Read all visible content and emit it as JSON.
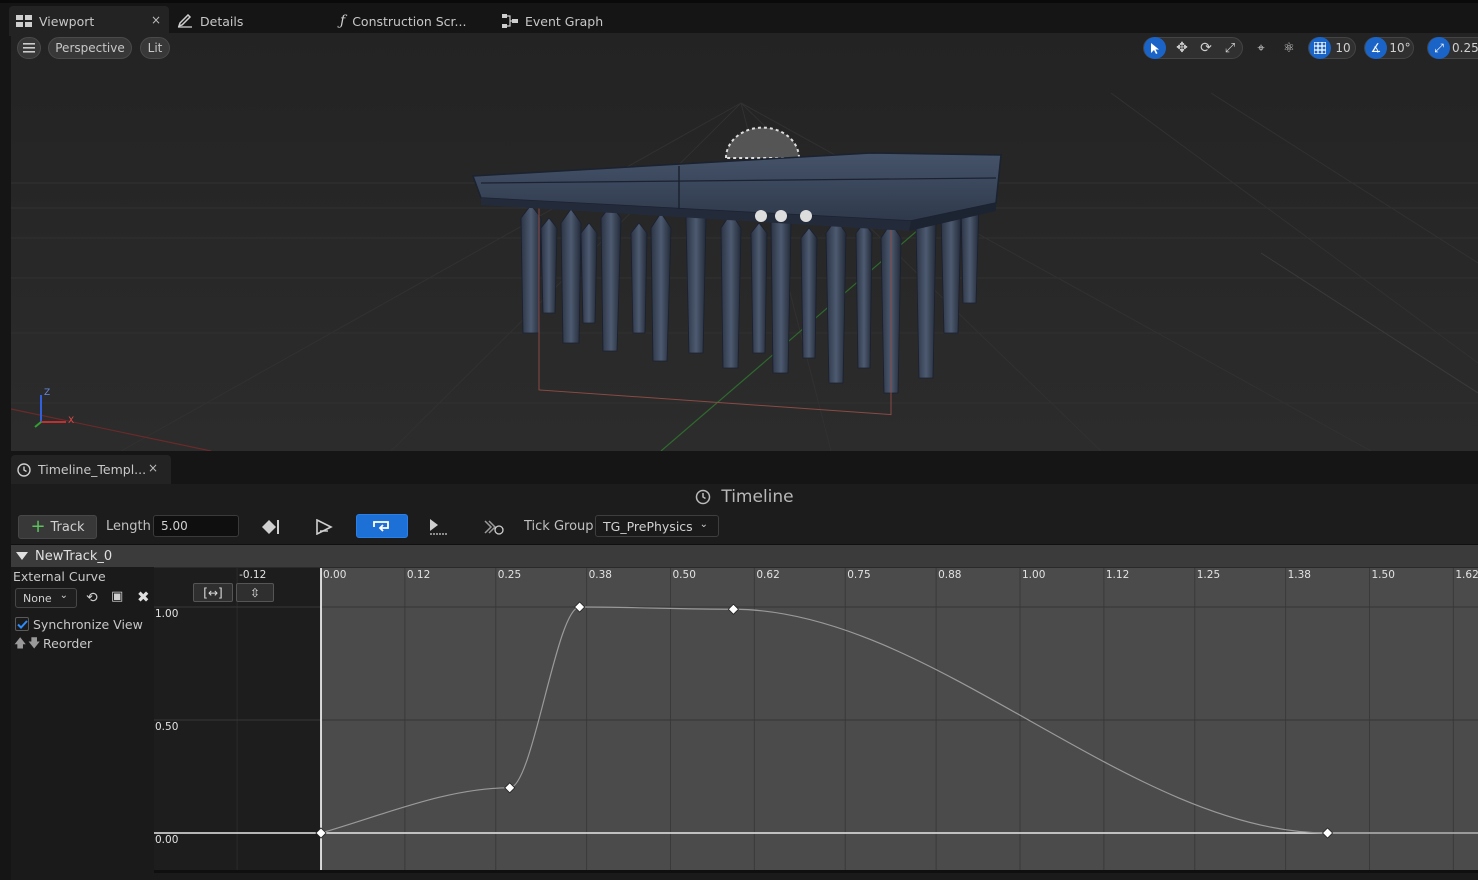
{
  "tabs": [
    {
      "label": "Viewport",
      "icon": "viewport-grid-icon",
      "active": true,
      "close": "×"
    },
    {
      "label": "Details",
      "icon": "pencil-icon"
    },
    {
      "label": "Construction Scr...",
      "icon": "function-icon"
    },
    {
      "label": "Event Graph",
      "icon": "graph-nodes-icon"
    }
  ],
  "viewport": {
    "view_mode": "Perspective",
    "lighting": "Lit",
    "grid_snap": "10",
    "rotation_snap": "10°",
    "scale_snap": "0.25",
    "axis_x": "X",
    "axis_z": "Z"
  },
  "timeline_tab": {
    "label": "Timeline_Templ...",
    "close": "×"
  },
  "timeline": {
    "title": "Timeline",
    "track_button": "Track",
    "length_label": "Length",
    "length_value": "5.00",
    "tick_group_label": "Tick Group",
    "tick_group_value": "TG_PrePhysics",
    "loop_active": true
  },
  "track": {
    "name": "NewTrack_0",
    "external_curve_label": "External Curve",
    "external_curve_value": "None",
    "synchronize_view_label": "Synchronize View",
    "synchronize_view_checked": true,
    "reorder_label": "Reorder"
  },
  "curve": {
    "x_ticks": [
      "-0.12",
      "0.00",
      "0.12",
      "0.25",
      "0.38",
      "0.50",
      "0.62",
      "0.75",
      "0.88",
      "1.00",
      "1.12",
      "1.25",
      "1.38",
      "1.50",
      "1.62"
    ],
    "y_ticks": [
      "1.00",
      "0.50",
      "0.00"
    ],
    "keys": [
      {
        "time": 0.0,
        "value": 0.0
      },
      {
        "time": 0.27,
        "value": 0.2
      },
      {
        "time": 0.37,
        "value": 1.0
      },
      {
        "time": 0.59,
        "value": 0.99
      },
      {
        "time": 1.44,
        "value": 0.0
      }
    ]
  },
  "colors": {
    "accent": "#1d70d6",
    "graph_bg": "#4b4b4b",
    "panel_bg": "#1c1c1c"
  }
}
